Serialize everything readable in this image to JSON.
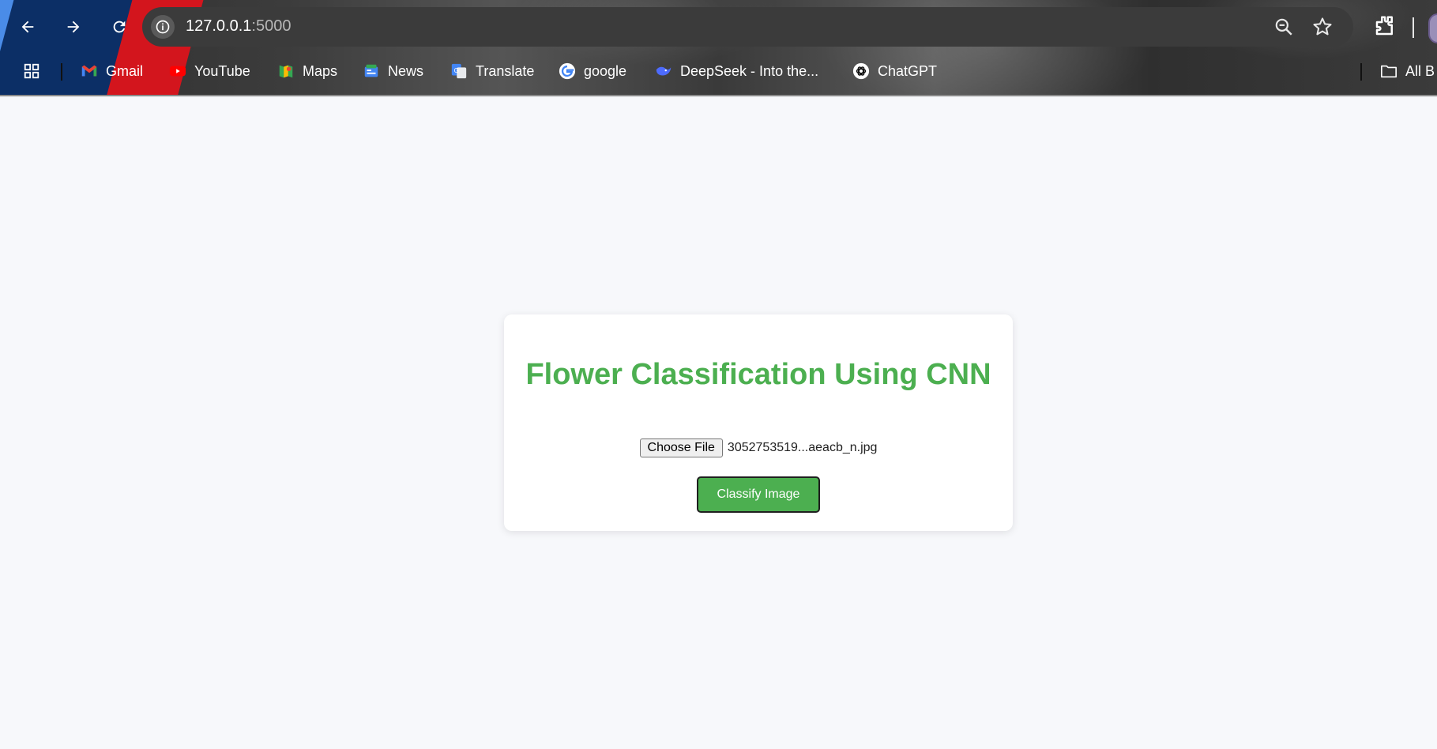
{
  "browser": {
    "url_host": "127.0.0.1",
    "url_port": ":5000",
    "nav_icons": [
      "back-arrow-icon",
      "forward-arrow-icon",
      "reload-icon"
    ],
    "bookmarks": [
      {
        "label": "Gmail",
        "icon": "gmail-icon"
      },
      {
        "label": "YouTube",
        "icon": "youtube-icon"
      },
      {
        "label": "Maps",
        "icon": "maps-icon"
      },
      {
        "label": "News",
        "icon": "news-icon"
      },
      {
        "label": "Translate",
        "icon": "translate-icon"
      },
      {
        "label": "google",
        "icon": "google-icon"
      },
      {
        "label": "DeepSeek - Into the...",
        "icon": "deepseek-icon"
      },
      {
        "label": "ChatGPT",
        "icon": "chatgpt-icon"
      }
    ],
    "all_bookmarks_label": "All B"
  },
  "page": {
    "title": "Flower Classification Using CNN",
    "file_button_label": "Choose File",
    "file_name": "3052753519...aeacb_n.jpg",
    "submit_label": "Classify Image"
  },
  "colors": {
    "accent_green": "#4caf50",
    "page_bg": "#f7f8fb"
  }
}
